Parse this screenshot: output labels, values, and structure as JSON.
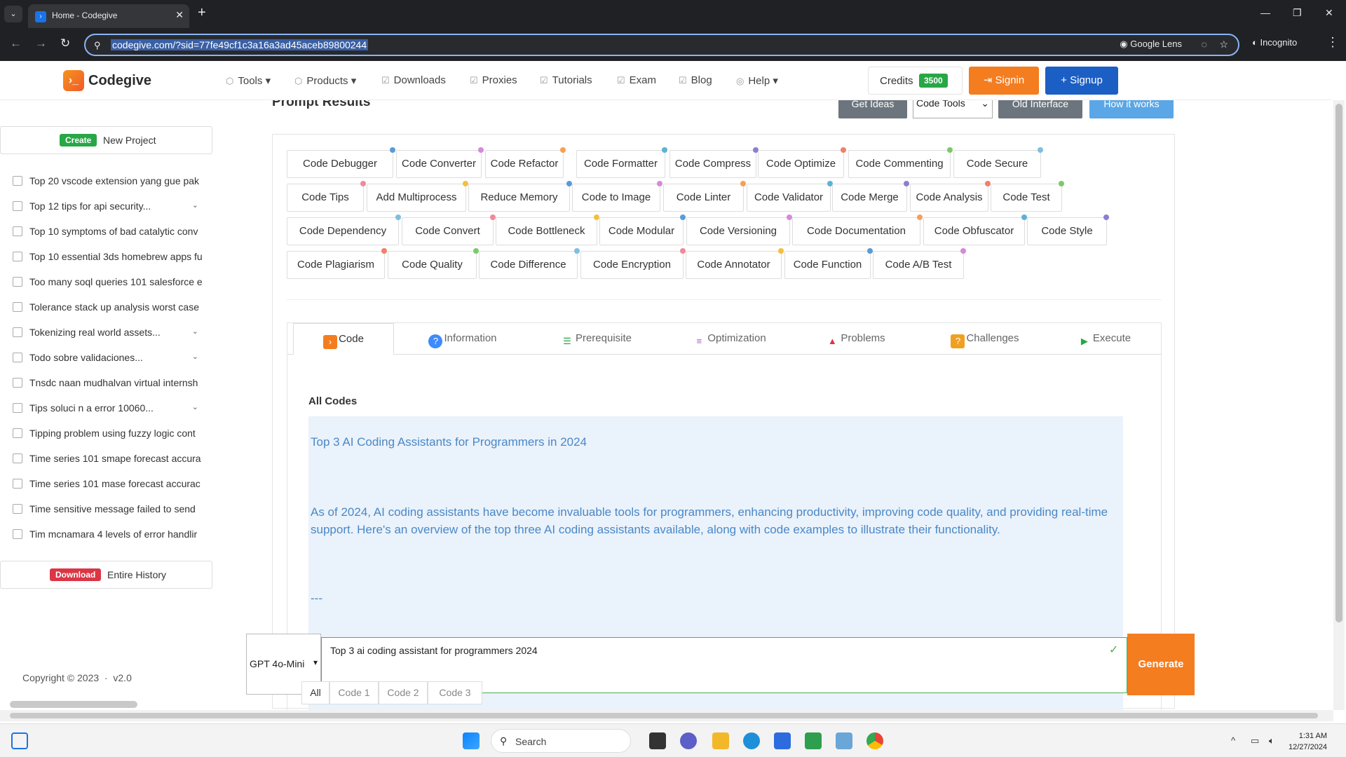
{
  "browser": {
    "tab_title": "Home - Codegive",
    "url": "codegive.com/?sid=77fe49cf1c3a16a3ad45aceb89800244",
    "lens_label": "Google Lens",
    "incognito_label": "Incognito"
  },
  "header": {
    "logo_text": "Codegive",
    "nav": [
      "Tools",
      "Products",
      "Downloads",
      "Proxies",
      "Tutorials",
      "Exam",
      "Blog",
      "Help"
    ],
    "credits_label": "Credits",
    "credits_value": "3500",
    "signin_label": "Signin",
    "signup_label": "Signup"
  },
  "sidebar": {
    "create_badge": "Create",
    "create_label": "New Project",
    "history": [
      {
        "label": "Top 20 vscode extension yang gue pak",
        "expandable": false
      },
      {
        "label": "Top 12 tips for api security...",
        "expandable": true
      },
      {
        "label": "Top 10 symptoms of bad catalytic conv",
        "expandable": false
      },
      {
        "label": "Top 10 essential 3ds homebrew apps fu",
        "expandable": false
      },
      {
        "label": "Too many soql queries 101 salesforce e",
        "expandable": false
      },
      {
        "label": "Tolerance stack up analysis worst case",
        "expandable": false
      },
      {
        "label": "Tokenizing real world assets...",
        "expandable": true
      },
      {
        "label": "Todo sobre validaciones...",
        "expandable": true
      },
      {
        "label": "Tnsdc naan mudhalvan virtual internsh",
        "expandable": false
      },
      {
        "label": "Tips soluci n a error 10060...",
        "expandable": true
      },
      {
        "label": "Tipping problem using fuzzy logic cont",
        "expandable": false
      },
      {
        "label": "Time series 101 smape forecast accura",
        "expandable": false
      },
      {
        "label": "Time series 101 mase forecast accurac",
        "expandable": false
      },
      {
        "label": "Time sensitive message failed to send",
        "expandable": false
      },
      {
        "label": "Tim mcnamara 4 levels of error handlir",
        "expandable": false
      }
    ],
    "download_badge": "Download",
    "download_label": "Entire History",
    "copyright": "Copyright © 2023",
    "version": "v2.0"
  },
  "main": {
    "page_title": "Prompt Results",
    "get_ideas_label": "Get Ideas",
    "tools_select_value": "Code Tools",
    "old_interface_label": "Old Interface",
    "how_it_works_label": "How it works",
    "tools": [
      "Code Debugger",
      "Code Converter",
      "Code Refactor",
      "Code Formatter",
      "Code Compress",
      "Code Optimize",
      "Code Commenting",
      "Code Secure",
      "Code Tips",
      "Add Multiprocess",
      "Reduce Memory",
      "Code to Image",
      "Code Linter",
      "Code Validator",
      "Code Merge",
      "Code Analysis",
      "Code Test",
      "Code Dependency",
      "Code Convert",
      "Code Bottleneck",
      "Code Modular",
      "Code Versioning",
      "Code Documentation",
      "Code Obfuscator",
      "Code Style",
      "Code Plagiarism",
      "Code Quality",
      "Code Difference",
      "Code Encryption",
      "Code Annotator",
      "Code Function",
      "Code A/B Test"
    ],
    "result_tabs": [
      "Code",
      "Information",
      "Prerequisite",
      "Optimization",
      "Problems",
      "Challenges",
      "Execute"
    ],
    "all_codes_label": "All Codes",
    "code_title": "Top 3 AI Coding Assistants for Programmers in 2024",
    "code_paragraph": "As of 2024, AI coding assistants have become invaluable tools for programmers, enhancing productivity, improving code quality, and providing real-time support. Here's an overview of the top three AI coding assistants available, along with code examples to illustrate their functionality.",
    "code_separator": "---"
  },
  "prompt": {
    "model_value": "GPT 4o-Mini",
    "input_value": "Top 3 ai coding assistant for programmers 2024",
    "generate_label": "Generate",
    "code_pills": [
      "All",
      "Code 1",
      "Code 2",
      "Code 3"
    ]
  },
  "taskbar": {
    "search_placeholder": "Search",
    "time": "1:31 AM",
    "date": "12/27/2024"
  },
  "colors": {
    "brand_orange": "#f47d20",
    "brand_blue": "#1c5fc4",
    "credits_green": "#28a745",
    "code_text": "#4a88c7"
  }
}
